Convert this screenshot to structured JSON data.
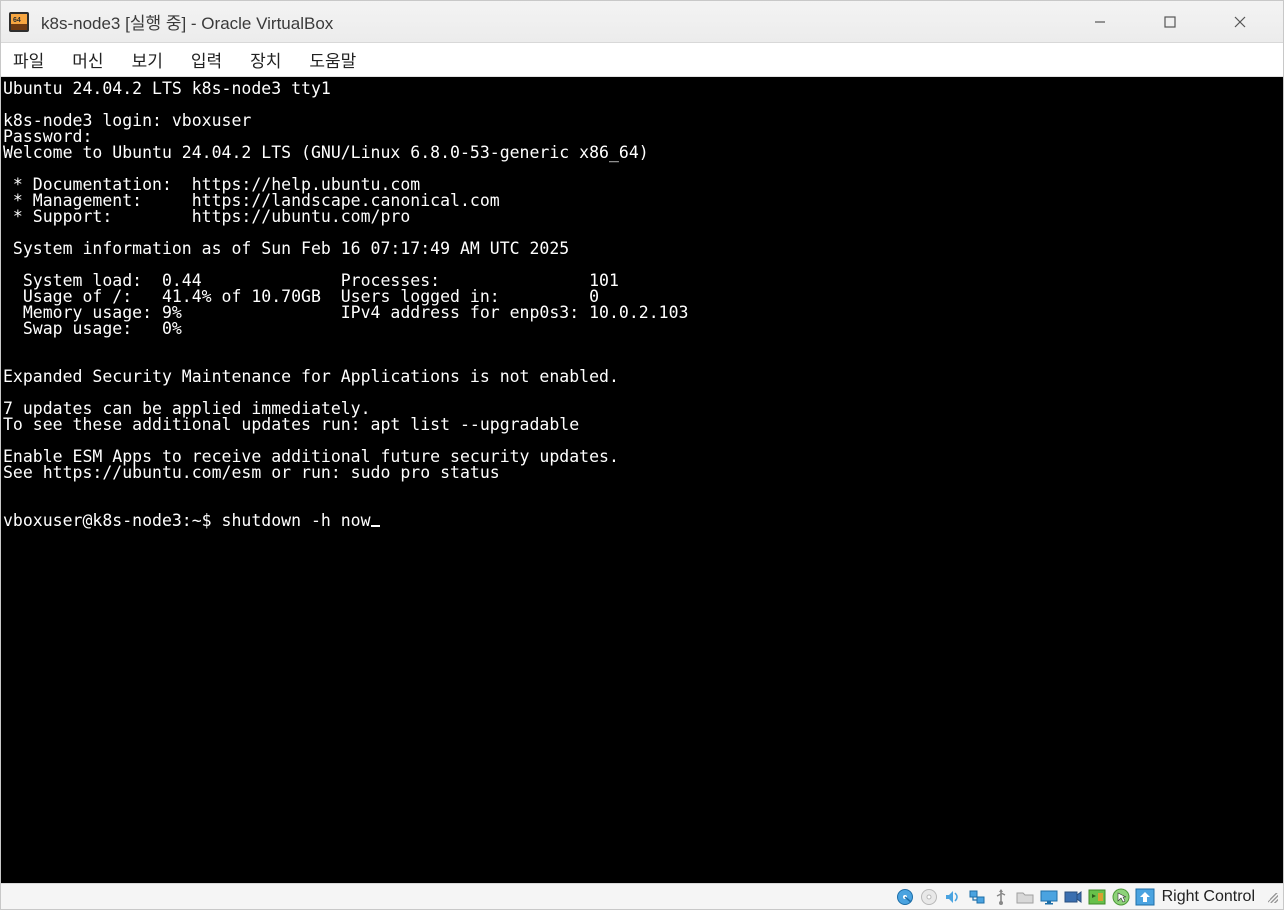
{
  "titlebar": {
    "title": "k8s-node3 [실행 중] - Oracle VirtualBox"
  },
  "menubar": {
    "file": "파일",
    "machine": "머신",
    "view": "보기",
    "input": "입력",
    "devices": "장치",
    "help": "도움말"
  },
  "terminal": {
    "lines": [
      "Ubuntu 24.04.2 LTS k8s-node3 tty1",
      "",
      "k8s-node3 login: vboxuser",
      "Password:",
      "Welcome to Ubuntu 24.04.2 LTS (GNU/Linux 6.8.0-53-generic x86_64)",
      "",
      " * Documentation:  https://help.ubuntu.com",
      " * Management:     https://landscape.canonical.com",
      " * Support:        https://ubuntu.com/pro",
      "",
      " System information as of Sun Feb 16 07:17:49 AM UTC 2025",
      "",
      "  System load:  0.44              Processes:               101",
      "  Usage of /:   41.4% of 10.70GB  Users logged in:         0",
      "  Memory usage: 9%                IPv4 address for enp0s3: 10.0.2.103",
      "  Swap usage:   0%",
      "",
      "",
      "Expanded Security Maintenance for Applications is not enabled.",
      "",
      "7 updates can be applied immediately.",
      "To see these additional updates run: apt list --upgradable",
      "",
      "Enable ESM Apps to receive additional future security updates.",
      "See https://ubuntu.com/esm or run: sudo pro status",
      "",
      ""
    ],
    "prompt": "vboxuser@k8s-node3:~$ shutdown -h now"
  },
  "statusbar": {
    "host_key": "Right Control"
  }
}
